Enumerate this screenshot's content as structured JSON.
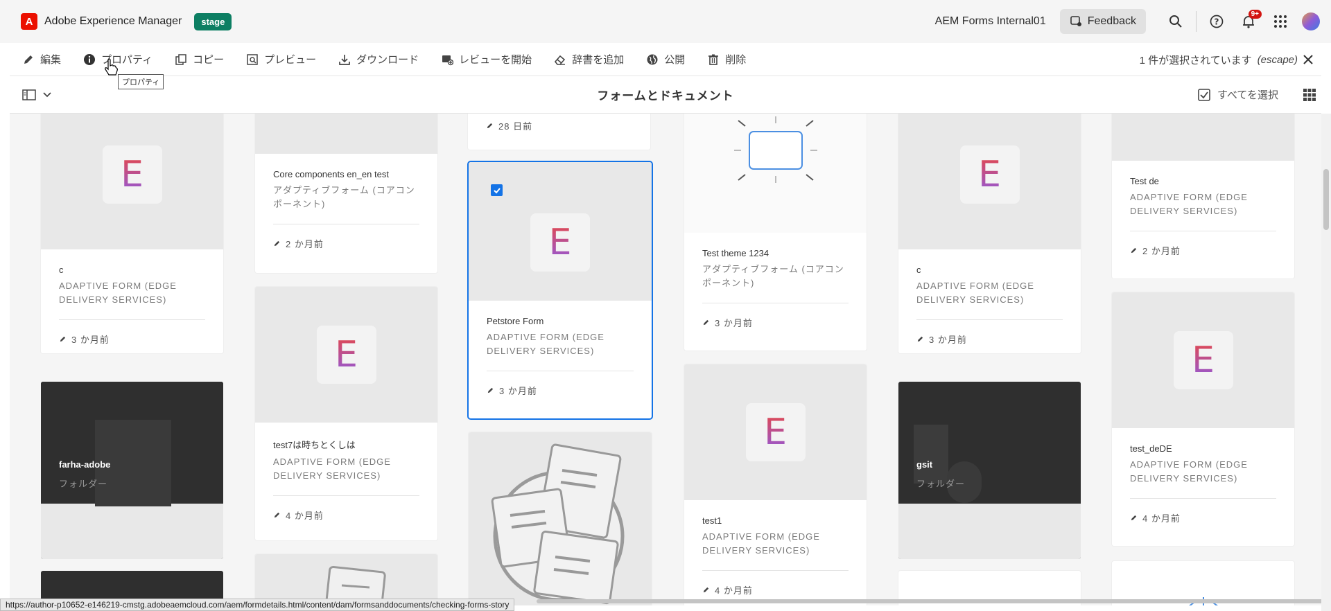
{
  "header": {
    "logo_letter": "A",
    "app_title": "Adobe Experience Manager",
    "env_badge": "stage",
    "org_name": "AEM Forms Internal01",
    "feedback_label": "Feedback",
    "notifications_badge": "9+"
  },
  "actions": {
    "edit": "編集",
    "properties": "プロパティ",
    "copy": "コピー",
    "preview": "プレビュー",
    "download": "ダウンロード",
    "start_review": "レビューを開始",
    "add_dictionary": "辞書を追加",
    "publish": "公開",
    "delete": "削除",
    "selection_info": "1 件が選択されています",
    "escape_hint": "(escape)",
    "tooltip": "プロパティ"
  },
  "view": {
    "title": "フォームとドキュメント",
    "select_all": "すべてを選択"
  },
  "cards": [
    {
      "name": "c",
      "type": "ADAPTIVE FORM (EDGE DELIVERY SERVICES)",
      "modified": "3 か月前"
    },
    {
      "name": "Core components en_en test",
      "type": "アダプティブフォーム (コアコンポーネント)",
      "modified": "2 か月前"
    },
    {
      "name": "test7は時ちとくしは",
      "type": "ADAPTIVE FORM (EDGE DELIVERY SERVICES)",
      "modified": "4 か月前"
    },
    {
      "modified": "28 日前"
    },
    {
      "name": "Petstore Form",
      "type": "ADAPTIVE FORM (EDGE DELIVERY SERVICES)",
      "modified": "3 か月前",
      "selected": true
    },
    {
      "name": "Test theme 1234",
      "type": "アダプティブフォーム (コアコンポーネント)",
      "modified": "3 か月前"
    },
    {
      "name": "test1",
      "type": "ADAPTIVE FORM (EDGE DELIVERY SERVICES)",
      "modified": "4 か月前"
    },
    {
      "name": "c",
      "type": "ADAPTIVE FORM (EDGE DELIVERY SERVICES)",
      "modified": "3 か月前"
    },
    {
      "name": "Test de",
      "type": "ADAPTIVE FORM (EDGE DELIVERY SERVICES)",
      "modified": "2 か月前"
    },
    {
      "name": "test_deDE",
      "type": "ADAPTIVE FORM (EDGE DELIVERY SERVICES)",
      "modified": "4 か月前"
    }
  ],
  "thumb_letter": "E",
  "folders": [
    {
      "name": "farha-adobe",
      "type": "フォルダー"
    },
    {
      "name": "gsit",
      "type": "フォルダー"
    }
  ],
  "status_url": "https://author-p10652-e146219-cmstg.adobeaemcloud.com/aem/formdetails.html/content/dam/formsanddocuments/checking-forms-story",
  "colors": {
    "accent": "#1473e6",
    "stage": "#0d7f63",
    "adobe_red": "#eb1000"
  }
}
